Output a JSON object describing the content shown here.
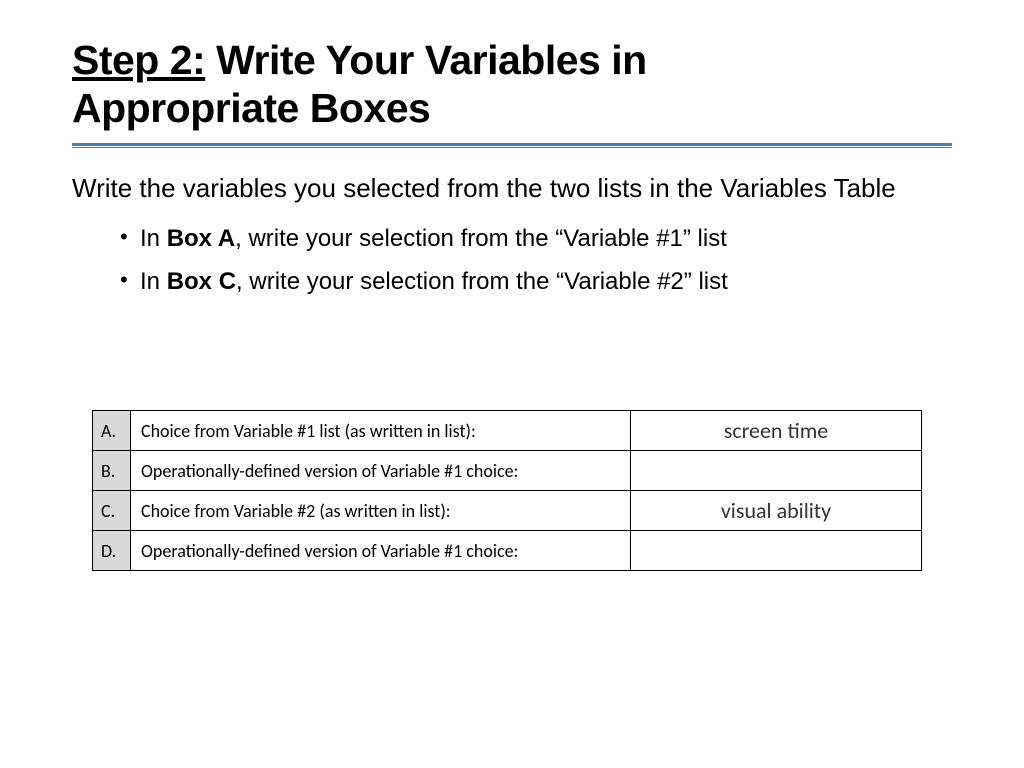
{
  "title": {
    "step": "Step 2:",
    "rest_line1": " Write Your Variables in",
    "line2": "Appropriate Boxes"
  },
  "intro": "Write the variables you selected from the two lists in the Variables Table",
  "bullets": [
    {
      "pre": "In ",
      "bold": "Box A",
      "post": ", write your selection from the “Variable #1” list"
    },
    {
      "pre": "In ",
      "bold": "Box C",
      "post": ", write your selection from the “Variable #2” list"
    }
  ],
  "table": {
    "rows": [
      {
        "letter": "A.",
        "desc": "Choice from Variable #1 list (as written in list):",
        "value": "screen time"
      },
      {
        "letter": "B.",
        "desc": "Operationally-defined version of Variable #1 choice:",
        "value": ""
      },
      {
        "letter": "C.",
        "desc": "Choice from Variable #2 (as written in list):",
        "value": "visual ability"
      },
      {
        "letter": "D.",
        "desc": "Operationally-defined version of Variable #1 choice:",
        "value": ""
      }
    ]
  }
}
